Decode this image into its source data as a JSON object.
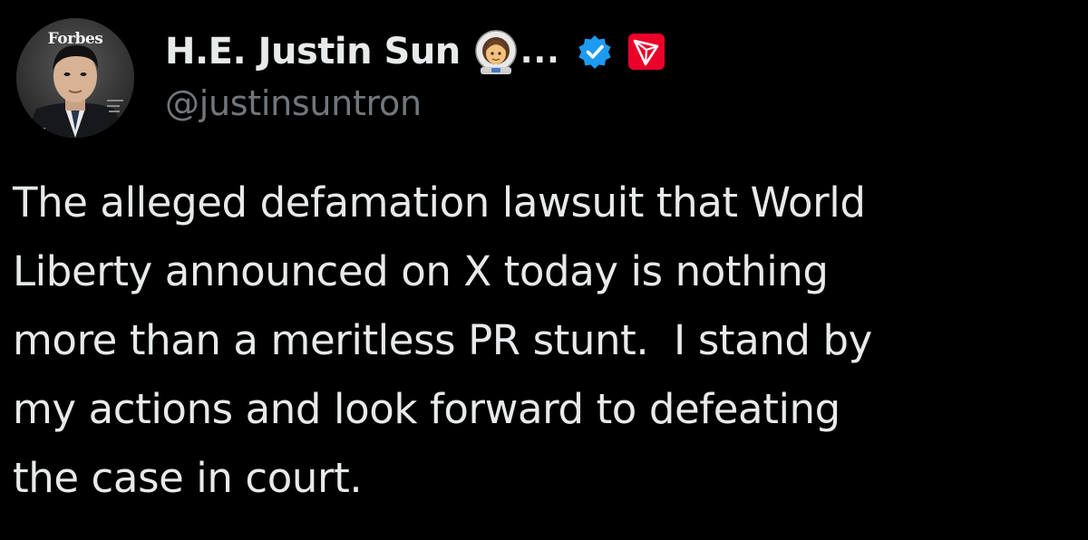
{
  "tweet": {
    "author": {
      "display_name": "H.E. Justin Sun",
      "truncation": "...",
      "handle": "@justinsuntron",
      "avatar_logo_text": "Forbes",
      "name_emoji": "astronaut-emoji",
      "verified_icon": "verified-badge-icon",
      "affiliate_icon": "tron-logo-icon"
    },
    "text": "The alleged defamation lawsuit that World\nLiberty announced on X today is nothing\nmore than a meritless PR stunt.  I stand by\nmy actions and look forward to defeating\nthe case in court."
  },
  "colors": {
    "background": "#000000",
    "primary_text": "#e7e9ea",
    "secondary_text": "#71767b",
    "verified_blue": "#1d9bf0",
    "tron_red": "#eb0029"
  }
}
